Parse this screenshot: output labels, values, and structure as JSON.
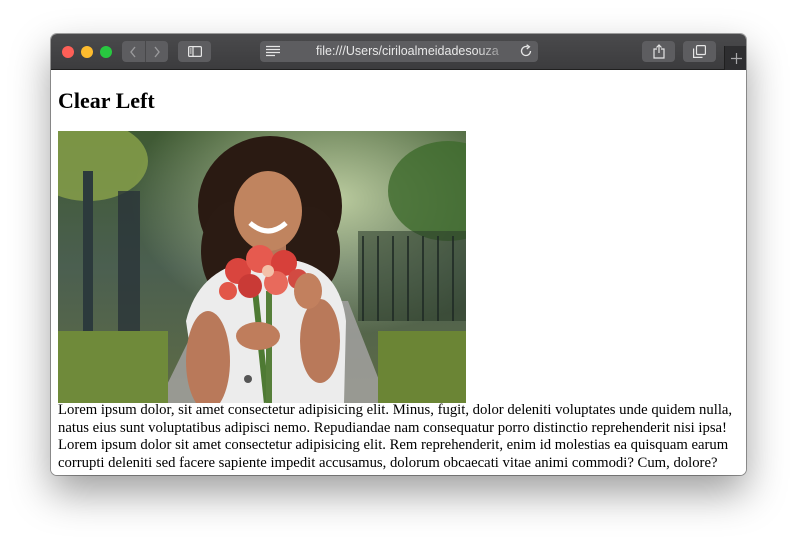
{
  "browser": {
    "url": "file:///Users/ciriloalmeidadesouza",
    "icons": {
      "back": "chevron-left-icon",
      "forward": "chevron-right-icon",
      "sidebar": "sidebar-icon",
      "reader": "reader-icon",
      "reload": "reload-icon",
      "share": "share-icon",
      "tabs": "tabs-icon",
      "new_tab": "plus-icon"
    },
    "traffic_lights": {
      "close": "#fe5f57",
      "minimize": "#febc2e",
      "zoom": "#28c840"
    }
  },
  "page": {
    "heading": "Clear Left",
    "image_description_icon": "photo-woman-with-flowers",
    "paragraph": "Lorem ipsum dolor, sit amet consectetur adipisicing elit. Minus, fugit, dolor deleniti voluptates unde quidem nulla, natus eius sunt voluptatibus adipisci nemo. Repudiandae nam consequatur porro distinctio reprehenderit nisi ipsa! Lorem ipsum dolor sit amet consectetur adipisicing elit. Rem reprehenderit, enim id molestias ea quisquam earum corrupti deleniti sed facere sapiente impedit accusamus, dolorum obcaecati vitae animi commodi? Cum, dolore?"
  }
}
